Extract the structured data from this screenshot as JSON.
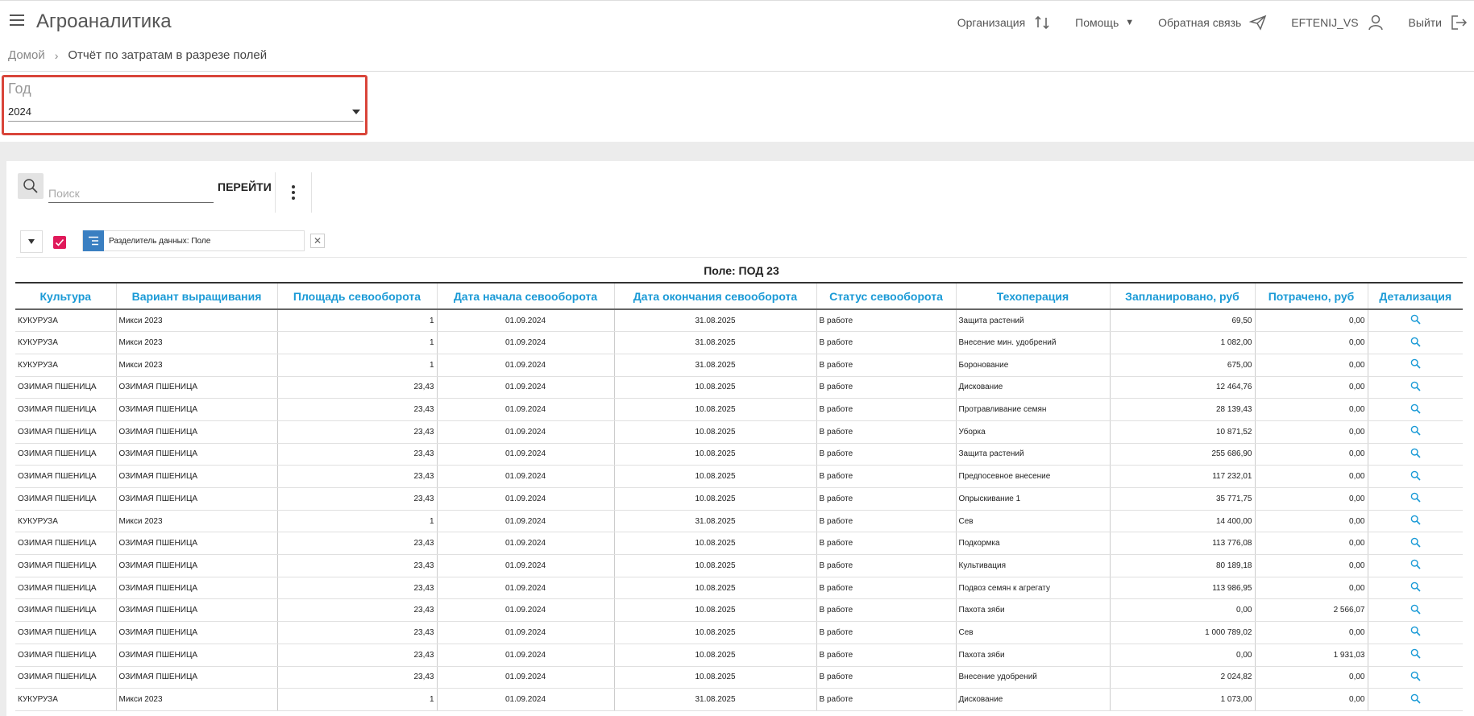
{
  "header": {
    "app_title": "Агроаналитика",
    "nav": {
      "organization": "Организация",
      "help": "Помощь",
      "feedback": "Обратная связь",
      "user": "EFTENIJ_VS",
      "logout": "Выйти"
    }
  },
  "breadcrumb": {
    "home": "Домой",
    "current": "Отчёт по затратам в разрезе полей"
  },
  "filters": {
    "year_label": "Год",
    "year_value": "2024"
  },
  "toolbar": {
    "search_placeholder": "Поиск",
    "go_label": "ПЕРЕЙТИ",
    "chip_label": "Разделитель данных: Поле",
    "accent_color": "#e0195a",
    "chip_color": "#3a7fc1",
    "highlight_color": "#d9453a"
  },
  "group_title": "Поле: ПОД 23",
  "table": {
    "columns": [
      "Культура",
      "Вариант выращивания",
      "Площадь севооборота",
      "Дата начала севооборота",
      "Дата окончания севооборота",
      "Статус севооборота",
      "Техоперация",
      "Запланировано, руб",
      "Потрачено, руб",
      "Детализация"
    ],
    "rows": [
      [
        "КУКУРУЗА",
        "Микси 2023",
        "1",
        "01.09.2024",
        "31.08.2025",
        "В работе",
        "Защита растений",
        "69,50",
        "0,00"
      ],
      [
        "КУКУРУЗА",
        "Микси 2023",
        "1",
        "01.09.2024",
        "31.08.2025",
        "В работе",
        "Внесение мин. удобрений",
        "1 082,00",
        "0,00"
      ],
      [
        "КУКУРУЗА",
        "Микси 2023",
        "1",
        "01.09.2024",
        "31.08.2025",
        "В работе",
        "Боронование",
        "675,00",
        "0,00"
      ],
      [
        "ОЗИМАЯ ПШЕНИЦА",
        "ОЗИМАЯ ПШЕНИЦА",
        "23,43",
        "01.09.2024",
        "10.08.2025",
        "В работе",
        "Дискование",
        "12 464,76",
        "0,00"
      ],
      [
        "ОЗИМАЯ ПШЕНИЦА",
        "ОЗИМАЯ ПШЕНИЦА",
        "23,43",
        "01.09.2024",
        "10.08.2025",
        "В работе",
        "Протравливание семян",
        "28 139,43",
        "0,00"
      ],
      [
        "ОЗИМАЯ ПШЕНИЦА",
        "ОЗИМАЯ ПШЕНИЦА",
        "23,43",
        "01.09.2024",
        "10.08.2025",
        "В работе",
        "Уборка",
        "10 871,52",
        "0,00"
      ],
      [
        "ОЗИМАЯ ПШЕНИЦА",
        "ОЗИМАЯ ПШЕНИЦА",
        "23,43",
        "01.09.2024",
        "10.08.2025",
        "В работе",
        "Защита растений",
        "255 686,90",
        "0,00"
      ],
      [
        "ОЗИМАЯ ПШЕНИЦА",
        "ОЗИМАЯ ПШЕНИЦА",
        "23,43",
        "01.09.2024",
        "10.08.2025",
        "В работе",
        "Предпосевное внесение",
        "117 232,01",
        "0,00"
      ],
      [
        "ОЗИМАЯ ПШЕНИЦА",
        "ОЗИМАЯ ПШЕНИЦА",
        "23,43",
        "01.09.2024",
        "10.08.2025",
        "В работе",
        "Опрыскивание 1",
        "35 771,75",
        "0,00"
      ],
      [
        "КУКУРУЗА",
        "Микси 2023",
        "1",
        "01.09.2024",
        "31.08.2025",
        "В работе",
        "Сев",
        "14 400,00",
        "0,00"
      ],
      [
        "ОЗИМАЯ ПШЕНИЦА",
        "ОЗИМАЯ ПШЕНИЦА",
        "23,43",
        "01.09.2024",
        "10.08.2025",
        "В работе",
        "Подкормка",
        "113 776,08",
        "0,00"
      ],
      [
        "ОЗИМАЯ ПШЕНИЦА",
        "ОЗИМАЯ ПШЕНИЦА",
        "23,43",
        "01.09.2024",
        "10.08.2025",
        "В работе",
        "Культивация",
        "80 189,18",
        "0,00"
      ],
      [
        "ОЗИМАЯ ПШЕНИЦА",
        "ОЗИМАЯ ПШЕНИЦА",
        "23,43",
        "01.09.2024",
        "10.08.2025",
        "В работе",
        "Подвоз семян к агрегату",
        "113 986,95",
        "0,00"
      ],
      [
        "ОЗИМАЯ ПШЕНИЦА",
        "ОЗИМАЯ ПШЕНИЦА",
        "23,43",
        "01.09.2024",
        "10.08.2025",
        "В работе",
        "Пахота зяби",
        "0,00",
        "2 566,07"
      ],
      [
        "ОЗИМАЯ ПШЕНИЦА",
        "ОЗИМАЯ ПШЕНИЦА",
        "23,43",
        "01.09.2024",
        "10.08.2025",
        "В работе",
        "Сев",
        "1 000 789,02",
        "0,00"
      ],
      [
        "ОЗИМАЯ ПШЕНИЦА",
        "ОЗИМАЯ ПШЕНИЦА",
        "23,43",
        "01.09.2024",
        "10.08.2025",
        "В работе",
        "Пахота зяби",
        "0,00",
        "1 931,03"
      ],
      [
        "ОЗИМАЯ ПШЕНИЦА",
        "ОЗИМАЯ ПШЕНИЦА",
        "23,43",
        "01.09.2024",
        "10.08.2025",
        "В работе",
        "Внесение удобрений",
        "2 024,82",
        "0,00"
      ],
      [
        "КУКУРУЗА",
        "Микси 2023",
        "1",
        "01.09.2024",
        "31.08.2025",
        "В работе",
        "Дискование",
        "1 073,00",
        "0,00"
      ]
    ]
  }
}
